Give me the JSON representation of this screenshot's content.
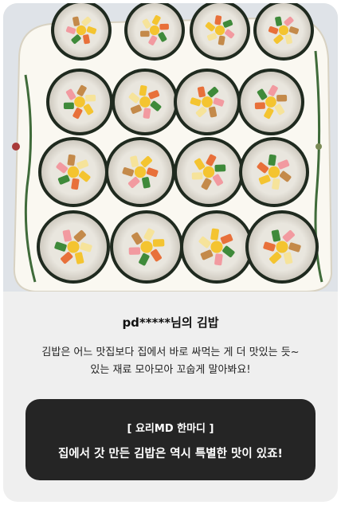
{
  "photo": {
    "alt_icon": "kimbap-photo"
  },
  "review": {
    "title": "pd*****님의 김밥",
    "desc_line1": "김밥은 어느 맛집보다 집에서 바로 싸먹는 게 더 맛있는 듯~",
    "desc_line2": "있는 재료 모아모아 꼬숩게 말아봐요!"
  },
  "md_comment": {
    "label": "[ 요리MD 한마디 ]",
    "text": "집에서 갓 만든 김밥은 역시 특별한 맛이 있죠!"
  },
  "colors": {
    "card_bg": "#efefef",
    "md_box_bg": "#252525",
    "text_dark": "#111111"
  }
}
